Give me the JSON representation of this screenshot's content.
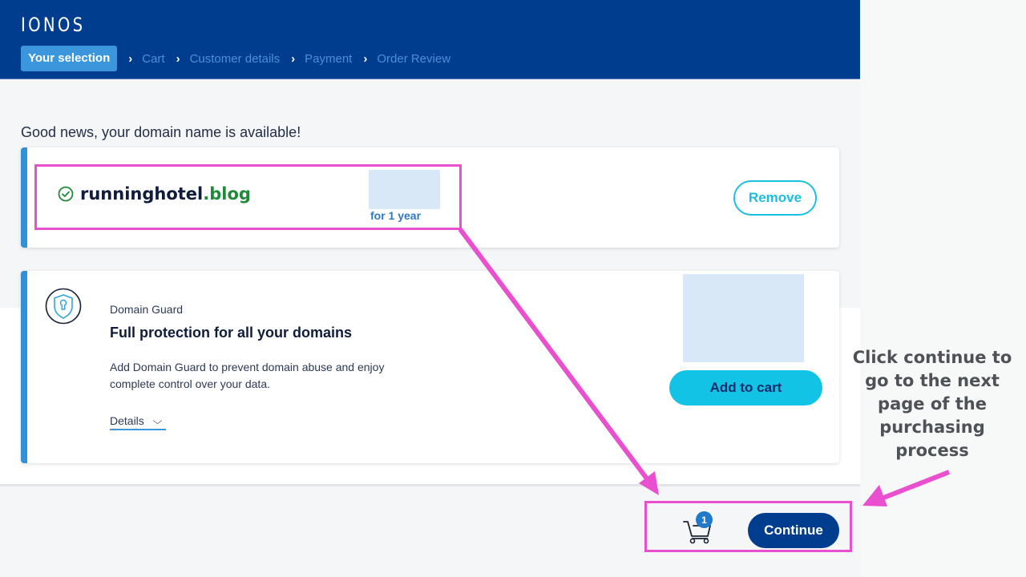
{
  "brand": {
    "logo": "IONOS"
  },
  "steps": [
    {
      "label": "Your selection",
      "active": true
    },
    {
      "label": "Cart",
      "active": false
    },
    {
      "label": "Customer details",
      "active": false
    },
    {
      "label": "Payment",
      "active": false
    },
    {
      "label": "Order Review",
      "active": false
    }
  ],
  "step_separator": "›",
  "main": {
    "headline": "Good news, your domain name is available!",
    "domain": {
      "name": "runninghotel",
      "tld": ".blog",
      "status_icon": "check-circle-icon",
      "price_term": "for 1 year",
      "remove_label": "Remove"
    },
    "domain_guard": {
      "icon": "shield-keyhole-icon",
      "label": "Domain Guard",
      "title": "Full protection for all your domains",
      "description": "Add Domain Guard to prevent domain abuse and enjoy complete control over your data.",
      "details_label": "Details",
      "details_icon": "chevron-down-icon",
      "add_to_cart_label": "Add to cart"
    }
  },
  "footer": {
    "cart_icon": "cart-icon",
    "cart_count": "1",
    "continue_label": "Continue"
  },
  "annotation": {
    "text": "Click continue to go to the next page of the purchasing process",
    "color": "#e94fcf"
  },
  "colors": {
    "header_bg": "#003d8f",
    "active_step_bg": "#3b96db",
    "card_accent": "#3290d6",
    "cyan_button": "#12c3e5",
    "primary_button": "#003d8f",
    "tld_green": "#1f8a3a"
  }
}
